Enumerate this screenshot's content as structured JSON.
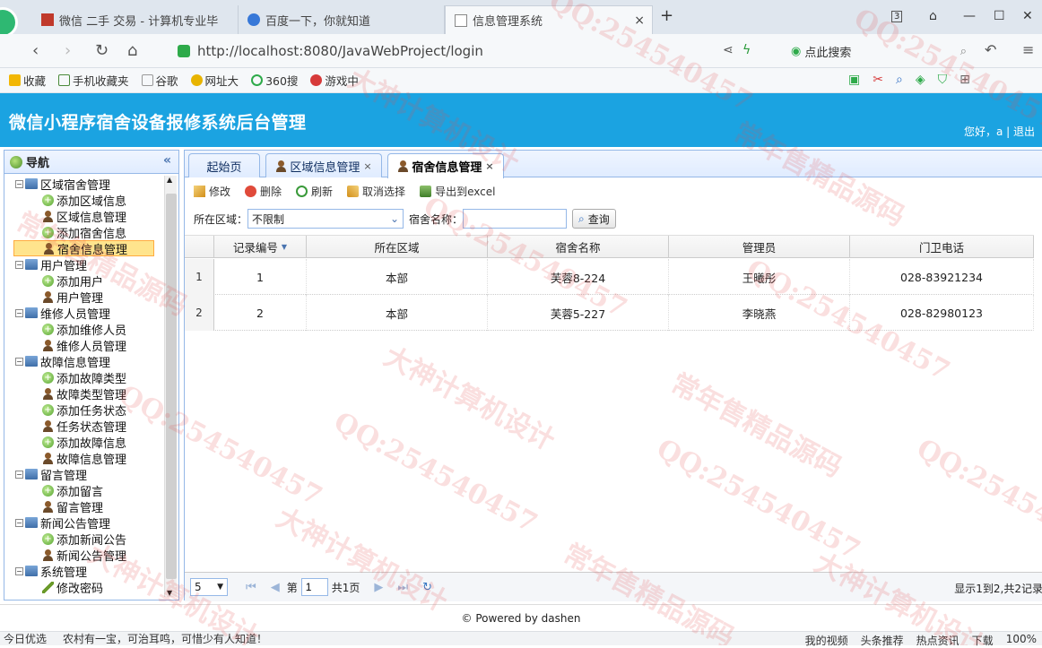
{
  "browser": {
    "tabs": [
      {
        "label": "微信 二手 交易 - 计算机专业毕",
        "icon": "weixin-tab-icon"
      },
      {
        "label": "百度一下，你就知道",
        "icon": "baidu-tab-icon"
      },
      {
        "label": "信息管理系统",
        "icon": "page-tab-icon"
      }
    ],
    "new_tab": "+",
    "tab_count": "3",
    "url": "http://localhost:8080/JavaWebProject/login",
    "search_placeholder": "点此搜索",
    "bookmarks": [
      "收藏",
      "手机收藏夹",
      "谷歌",
      "网址大",
      "360搜",
      "游戏中"
    ]
  },
  "app": {
    "title": "微信小程序宿舍设备报修系统后台管理",
    "greeting": "您好，a | 退出",
    "accent_color": "#1ba3e1"
  },
  "nav": {
    "header": "导航",
    "collapse_symbol": "«",
    "tree": [
      {
        "label": "区域宿舍管理",
        "type": "folder"
      },
      {
        "label": "添加区域信息",
        "type": "add"
      },
      {
        "label": "区域信息管理",
        "type": "user"
      },
      {
        "label": "添加宿舍信息",
        "type": "add"
      },
      {
        "label": "宿舍信息管理",
        "type": "user",
        "selected": true
      },
      {
        "label": "用户管理",
        "type": "folder"
      },
      {
        "label": "添加用户",
        "type": "add"
      },
      {
        "label": "用户管理",
        "type": "user"
      },
      {
        "label": "维修人员管理",
        "type": "folder"
      },
      {
        "label": "添加维修人员",
        "type": "add"
      },
      {
        "label": "维修人员管理",
        "type": "user"
      },
      {
        "label": "故障信息管理",
        "type": "folder"
      },
      {
        "label": "添加故障类型",
        "type": "add"
      },
      {
        "label": "故障类型管理",
        "type": "user"
      },
      {
        "label": "添加任务状态",
        "type": "add"
      },
      {
        "label": "任务状态管理",
        "type": "user"
      },
      {
        "label": "添加故障信息",
        "type": "add"
      },
      {
        "label": "故障信息管理",
        "type": "user"
      },
      {
        "label": "留言管理",
        "type": "folder"
      },
      {
        "label": "添加留言",
        "type": "add"
      },
      {
        "label": "留言管理",
        "type": "user"
      },
      {
        "label": "新闻公告管理",
        "type": "folder"
      },
      {
        "label": "添加新闻公告",
        "type": "add"
      },
      {
        "label": "新闻公告管理",
        "type": "user"
      },
      {
        "label": "系统管理",
        "type": "folder"
      },
      {
        "label": "修改密码",
        "type": "pen"
      }
    ]
  },
  "center_tabs": [
    {
      "label": "起始页",
      "closable": false
    },
    {
      "label": "区域信息管理",
      "closable": true
    },
    {
      "label": "宿舍信息管理",
      "closable": true,
      "active": true
    }
  ],
  "toolbar": {
    "edit": "修改",
    "delete": "删除",
    "refresh": "刷新",
    "cancel_select": "取消选择",
    "export": "导出到excel"
  },
  "filter": {
    "area_label": "所在区域：",
    "area_value": "不限制",
    "name_label": "宿舍名称：",
    "name_value": "",
    "query_button": "查询"
  },
  "grid": {
    "columns": [
      "记录编号",
      "所在区域",
      "宿舍名称",
      "管理员",
      "门卫电话"
    ],
    "rows": [
      {
        "rownum": "1",
        "cells": [
          "1",
          "本部",
          "芙蓉8-224",
          "王曦彤",
          "028-83921234"
        ]
      },
      {
        "rownum": "2",
        "cells": [
          "2",
          "本部",
          "芙蓉5-227",
          "李晓燕",
          "028-82980123"
        ]
      }
    ]
  },
  "pager": {
    "page_size": "5",
    "page_prefix": "第",
    "page_value": "1",
    "page_total": "共1页",
    "info": "显示1到2,共2记录"
  },
  "footer": {
    "text": "© Powered by dashen"
  },
  "statusbar": {
    "left": "今日优选",
    "news": "农村有一宝，可治耳鸣，可惜少有人知道！",
    "right": [
      "我的视频",
      "头条推荐",
      "热点资讯",
      "下载",
      "100%"
    ]
  },
  "watermarks": [
    "QQ:254540457",
    "大神计算机设计",
    "常年售精品源码"
  ]
}
